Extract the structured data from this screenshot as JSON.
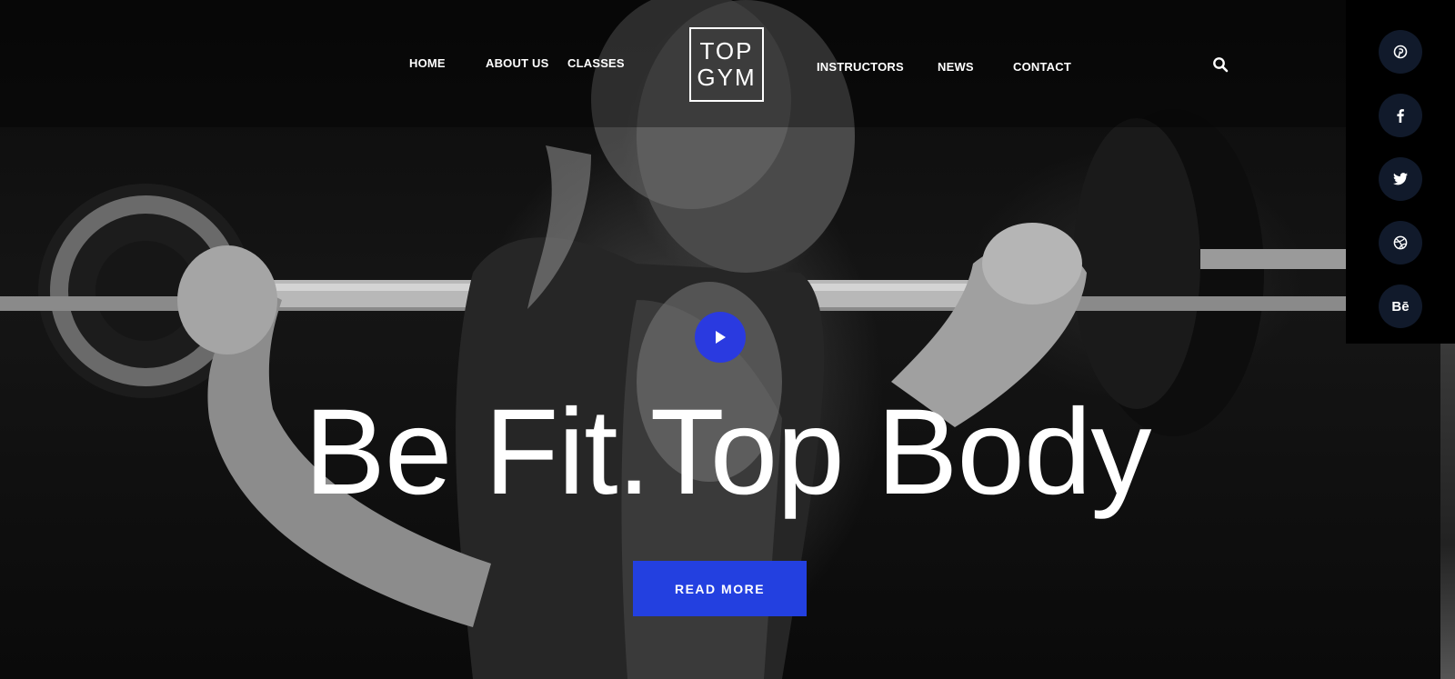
{
  "nav": {
    "items": [
      {
        "label": "HOME"
      },
      {
        "label": "ABOUT US"
      },
      {
        "label": "CLASSES"
      },
      {
        "label": "INSTRUCTORS"
      },
      {
        "label": "NEWS"
      },
      {
        "label": "CONTACT"
      }
    ],
    "search_icon": "search-icon"
  },
  "logo": {
    "line1": "TOP",
    "line2": "GYM"
  },
  "social": [
    {
      "name": "pinterest",
      "icon": "pinterest-icon"
    },
    {
      "name": "facebook",
      "icon": "facebook-icon"
    },
    {
      "name": "twitter",
      "icon": "twitter-icon"
    },
    {
      "name": "dribbble",
      "icon": "dribbble-icon"
    },
    {
      "name": "behance",
      "icon": "behance-icon",
      "glyph": "Bē"
    }
  ],
  "hero": {
    "headline": "Be Fit.Top Body",
    "cta_label": "READ MORE",
    "play_icon": "play-icon"
  },
  "colors": {
    "accent": "#2340e0",
    "play": "#2a3ae0",
    "social_bg": "#111a2b"
  }
}
